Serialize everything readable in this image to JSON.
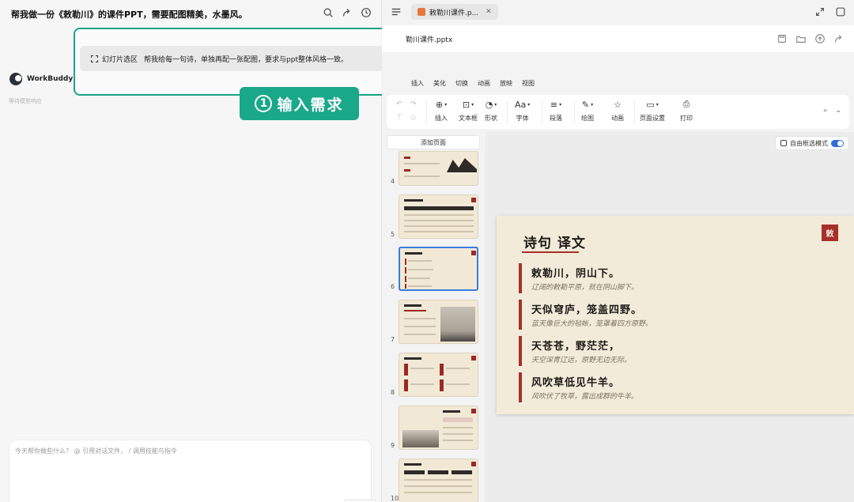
{
  "chat": {
    "title": "帮我做一份《敕勒川》的课件PPT，需要配图精美，水墨风。",
    "header_icons": [
      "search-icon",
      "share-icon",
      "history-icon"
    ],
    "agent_name": "WorkBuddy",
    "status": "等待模型响应",
    "composer_placeholder": "今天帮你做些什么？  @ 引用对话文件， / 调用技能与指令"
  },
  "callout": {
    "selection_label": "幻灯片选区",
    "request": "帮我给每一句诗，单独再配一张配图，要求与ppt整体风格一致。",
    "step_number": "①",
    "step_text": "输入需求"
  },
  "app": {
    "tab_title": "敕勒川课件.p...",
    "file_name": "勒川课件.pptx",
    "menu": [
      "插入",
      "美化",
      "切换",
      "动画",
      "放映",
      "视图"
    ],
    "ribbon": {
      "insert": "插入",
      "textbox": "文本框",
      "shape": "形状",
      "font": "字体",
      "paragraph": "段落",
      "draw": "绘图",
      "animation": "动画",
      "page_setup": "页面设置",
      "print": "打印"
    },
    "add_page": "添加页面",
    "free_select": "自由框选模式",
    "thumbnails": [
      {
        "num": "4"
      },
      {
        "num": "5"
      },
      {
        "num": "6"
      },
      {
        "num": "7"
      },
      {
        "num": "8"
      },
      {
        "num": "9"
      },
      {
        "num": "10"
      }
    ]
  },
  "slide": {
    "title": "诗句 译文",
    "seal": "敕",
    "verses": [
      {
        "line": "敕勒川，阴山下。",
        "translation": "辽阔的敕勒平原，就在阴山脚下。"
      },
      {
        "line": "天似穹庐，笼盖四野。",
        "translation": "蓝天像巨大的毡帐，笼罩着四方原野。"
      },
      {
        "line": "天苍苍，野茫茫，",
        "translation": "天空深青辽远，原野无边无际。"
      },
      {
        "line": "风吹草低见牛羊。",
        "translation": "风吹伏了牧草，露出成群的牛羊。"
      }
    ]
  },
  "colors": {
    "accent": "#19a889",
    "seal_red": "#a6302a",
    "paper": "#f3ebd9",
    "selection_blue": "#3b7be0"
  }
}
